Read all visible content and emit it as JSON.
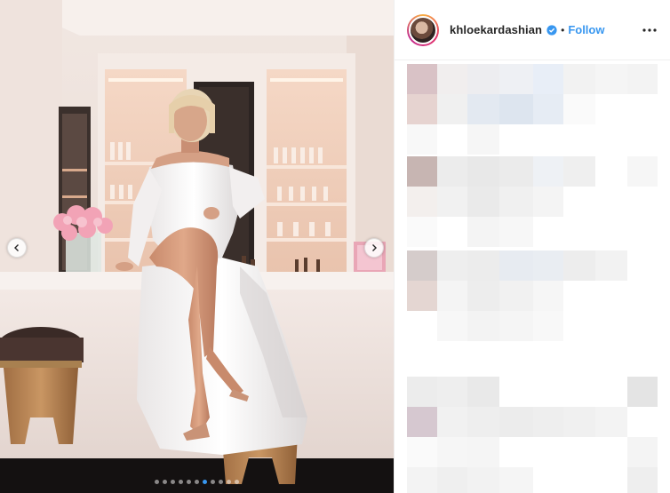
{
  "post": {
    "username": "khloekardashian",
    "verified_icon": "verified-badge-icon",
    "separator": "•",
    "follow_label": "Follow",
    "more_icon": "more-options-icon"
  },
  "carousel": {
    "total_slides": 11,
    "active_slide": 7,
    "prev_icon": "chevron-left-icon",
    "next_icon": "chevron-right-icon",
    "active_dot_color": "#3897f0"
  },
  "colors": {
    "link_blue": "#3897f0",
    "text_dark": "#262626",
    "border": "#efefef"
  }
}
